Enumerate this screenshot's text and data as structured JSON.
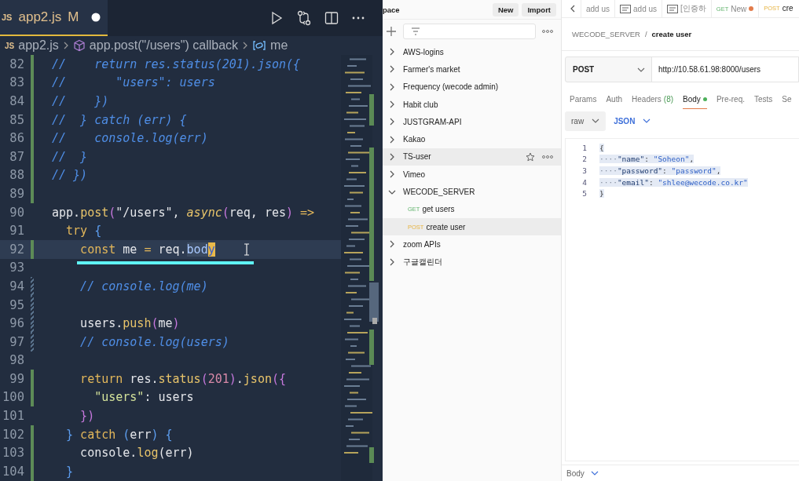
{
  "editor": {
    "tab": {
      "icon": "JS",
      "filename": "app2.js",
      "status": "M",
      "modified": true
    },
    "breadcrumb": {
      "icon": "JS",
      "file": "app2.js",
      "symbol": "app.post(\"/users\") callback",
      "variable": "me"
    },
    "lines": [
      {
        "number": "82",
        "added": true,
        "changed": false,
        "current": false,
        "tokens": [
          {
            "kind": "comment",
            "text": "//    return res.status(201).json({"
          }
        ]
      },
      {
        "number": "83",
        "added": true,
        "changed": false,
        "current": false,
        "tokens": [
          {
            "kind": "comment",
            "text": "//       \"users\": users"
          }
        ]
      },
      {
        "number": "84",
        "added": true,
        "changed": false,
        "current": false,
        "tokens": [
          {
            "kind": "comment",
            "text": "//    })"
          }
        ]
      },
      {
        "number": "85",
        "added": true,
        "changed": false,
        "current": false,
        "tokens": [
          {
            "kind": "comment",
            "text": "//  } catch (err) {"
          }
        ]
      },
      {
        "number": "86",
        "added": true,
        "changed": false,
        "current": false,
        "tokens": [
          {
            "kind": "comment",
            "text": "//    console.log(err)"
          }
        ]
      },
      {
        "number": "87",
        "added": true,
        "changed": false,
        "current": false,
        "tokens": [
          {
            "kind": "comment",
            "text": "//  }"
          }
        ]
      },
      {
        "number": "88",
        "added": true,
        "changed": false,
        "current": false,
        "tokens": [
          {
            "kind": "comment",
            "text": "// })"
          }
        ]
      },
      {
        "number": "89",
        "added": true,
        "changed": false,
        "current": false
      },
      {
        "number": "90",
        "added": false,
        "changed": false,
        "current": false,
        "tokens": [
          {
            "kind": "plain",
            "text": "app."
          },
          {
            "kind": "func",
            "text": "post"
          },
          {
            "kind": "bracket",
            "text": "("
          },
          {
            "kind": "plain",
            "text": "\"/users\", "
          },
          {
            "kind": "async",
            "text": "async"
          },
          {
            "kind": "bracket",
            "text": "("
          },
          {
            "kind": "plain",
            "text": "req, res"
          },
          {
            "kind": "bracket",
            "text": ")"
          },
          {
            "kind": "keyword",
            "text": " =>"
          }
        ]
      },
      {
        "number": "91",
        "added": false,
        "changed": false,
        "current": false,
        "tokens": [
          {
            "kind": "keyword",
            "text": "  try"
          },
          {
            "kind": "brace",
            "text": " {"
          }
        ]
      },
      {
        "number": "92",
        "added": true,
        "changed": false,
        "current": true,
        "tokens": [
          {
            "kind": "keyword",
            "text": "    const"
          },
          {
            "kind": "plain",
            "text": " me "
          },
          {
            "kind": "keyword",
            "text": "="
          },
          {
            "kind": "plain",
            "text": " req."
          },
          {
            "kind": "match",
            "text": "bod"
          },
          {
            "kind": "cursor",
            "text": "y"
          }
        ]
      },
      {
        "number": "93",
        "added": false,
        "changed": false,
        "current": false
      },
      {
        "number": "94",
        "added": false,
        "changed": true,
        "current": false,
        "tokens": [
          {
            "kind": "comment",
            "text": "    // console.log(me)"
          }
        ]
      },
      {
        "number": "95",
        "added": false,
        "changed": true,
        "current": false
      },
      {
        "number": "96",
        "added": false,
        "changed": true,
        "current": false,
        "tokens": [
          {
            "kind": "plain",
            "text": "    users."
          },
          {
            "kind": "func",
            "text": "push"
          },
          {
            "kind": "bracket",
            "text": "("
          },
          {
            "kind": "plain",
            "text": "me"
          },
          {
            "kind": "bracket",
            "text": ")"
          }
        ]
      },
      {
        "number": "97",
        "added": false,
        "changed": true,
        "current": false,
        "tokens": [
          {
            "kind": "comment",
            "text": "    // console.log(users)"
          }
        ]
      },
      {
        "number": "98",
        "added": false,
        "changed": false,
        "current": false
      },
      {
        "number": "99",
        "added": true,
        "changed": false,
        "current": false,
        "tokens": [
          {
            "kind": "keyword",
            "text": "    return"
          },
          {
            "kind": "plain",
            "text": " res."
          },
          {
            "kind": "func",
            "text": "status"
          },
          {
            "kind": "bracket",
            "text": "("
          },
          {
            "kind": "number",
            "text": "201"
          },
          {
            "kind": "bracket",
            "text": ")"
          },
          {
            "kind": "plain",
            "text": "."
          },
          {
            "kind": "func",
            "text": "json"
          },
          {
            "kind": "bracket",
            "text": "("
          },
          {
            "kind": "bracket",
            "text": "{"
          }
        ]
      },
      {
        "number": "100",
        "added": true,
        "changed": false,
        "current": false,
        "tokens": [
          {
            "kind": "string",
            "text": "      \"users\""
          },
          {
            "kind": "plain",
            "text": ": users"
          }
        ]
      },
      {
        "number": "101",
        "added": false,
        "changed": false,
        "current": false,
        "tokens": [
          {
            "kind": "bracket",
            "text": "    })"
          }
        ]
      },
      {
        "number": "102",
        "added": true,
        "changed": false,
        "current": false,
        "tokens": [
          {
            "kind": "brace",
            "text": "  }"
          },
          {
            "kind": "keyword",
            "text": " catch"
          },
          {
            "kind": "brace",
            "text": " ("
          },
          {
            "kind": "plain",
            "text": "err"
          },
          {
            "kind": "brace",
            "text": ")"
          },
          {
            "kind": "brace",
            "text": " {"
          }
        ]
      },
      {
        "number": "103",
        "added": true,
        "changed": false,
        "current": false,
        "tokens": [
          {
            "kind": "plain",
            "text": "    console."
          },
          {
            "kind": "func",
            "text": "log"
          },
          {
            "kind": "plain",
            "text": "(err)"
          }
        ]
      },
      {
        "number": "104",
        "added": true,
        "changed": false,
        "current": false,
        "tokens": [
          {
            "kind": "brace",
            "text": "  }"
          }
        ]
      }
    ]
  },
  "sidebar": {
    "workspace": "pace",
    "buttons": [
      "New",
      "Import"
    ],
    "collections": [
      {
        "name": "AWS-logins",
        "expanded": false,
        "hovered": false
      },
      {
        "name": "Farmer's market",
        "expanded": false,
        "hovered": false
      },
      {
        "name": "Frequency (wecode admin)",
        "expanded": false,
        "hovered": false
      },
      {
        "name": "Habit club",
        "expanded": false,
        "hovered": false
      },
      {
        "name": "JUSTGRAM-API",
        "expanded": false,
        "hovered": false
      },
      {
        "name": "Kakao",
        "expanded": false,
        "hovered": false
      },
      {
        "name": "TS-user",
        "expanded": false,
        "hovered": true
      },
      {
        "name": "Vimeo",
        "expanded": false,
        "hovered": false
      },
      {
        "name": "WECODE_SERVER",
        "expanded": true,
        "hovered": false,
        "children": [
          {
            "method": "GET",
            "name": "get users",
            "selected": false
          },
          {
            "method": "POST",
            "name": "create user",
            "selected": true
          }
        ]
      },
      {
        "name": "zoom APIs",
        "expanded": false,
        "hovered": false
      },
      {
        "name": "구글캘린더",
        "expanded": false,
        "hovered": false
      }
    ]
  },
  "request_tabs": [
    {
      "kind": "plain",
      "label": "add us",
      "unsaved": false,
      "selected": false
    },
    {
      "kind": "example",
      "label": "add us",
      "unsaved": false,
      "selected": false
    },
    {
      "kind": "example",
      "label": "[인증하",
      "unsaved": false,
      "selected": false
    },
    {
      "kind": "request",
      "method": "GET",
      "label": "New",
      "unsaved": true,
      "selected": false
    },
    {
      "kind": "request",
      "method": "POST",
      "label": "cre",
      "unsaved": false,
      "selected": true
    }
  ],
  "request": {
    "collection": "WECODE_SERVER",
    "separator": "/",
    "name": "create user",
    "method": "POST",
    "url": "http://10.58.61.98:8000/users",
    "tabs": [
      {
        "label": "Params",
        "selected": false
      },
      {
        "label": "Auth",
        "selected": false
      },
      {
        "label": "Headers",
        "count": "(8)",
        "selected": false
      },
      {
        "label": "Body",
        "indicator": true,
        "selected": true
      },
      {
        "label": "Pre-req.",
        "selected": false
      },
      {
        "label": "Tests",
        "selected": false
      },
      {
        "label": "Se",
        "selected": false
      }
    ],
    "body_mode": "raw",
    "body_format": "JSON",
    "body_lines": [
      {
        "number": "1",
        "selected": true,
        "tokens": [
          {
            "kind": "punct",
            "text": "{"
          }
        ]
      },
      {
        "number": "2",
        "selected": true,
        "tokens": [
          {
            "kind": "space",
            "text": "····"
          },
          {
            "kind": "key",
            "text": "\"name\""
          },
          {
            "kind": "punct",
            "text": ": "
          },
          {
            "kind": "value",
            "text": "\"Soheon\""
          },
          {
            "kind": "punct",
            "text": ","
          }
        ]
      },
      {
        "number": "3",
        "selected": true,
        "tokens": [
          {
            "kind": "space",
            "text": "····"
          },
          {
            "kind": "key",
            "text": "\"password\""
          },
          {
            "kind": "punct",
            "text": ": "
          },
          {
            "kind": "value",
            "text": "\"password\""
          },
          {
            "kind": "punct",
            "text": ","
          }
        ]
      },
      {
        "number": "4",
        "selected": true,
        "tokens": [
          {
            "kind": "space",
            "text": "····"
          },
          {
            "kind": "key",
            "text": "\"email\""
          },
          {
            "kind": "punct",
            "text": ": "
          },
          {
            "kind": "value",
            "text": "\"shlee@wecode.co.kr\""
          }
        ]
      },
      {
        "number": "5",
        "selected": true,
        "tokens": [
          {
            "kind": "punct",
            "text": "}"
          }
        ]
      }
    ]
  },
  "response": {
    "label": "Body"
  }
}
